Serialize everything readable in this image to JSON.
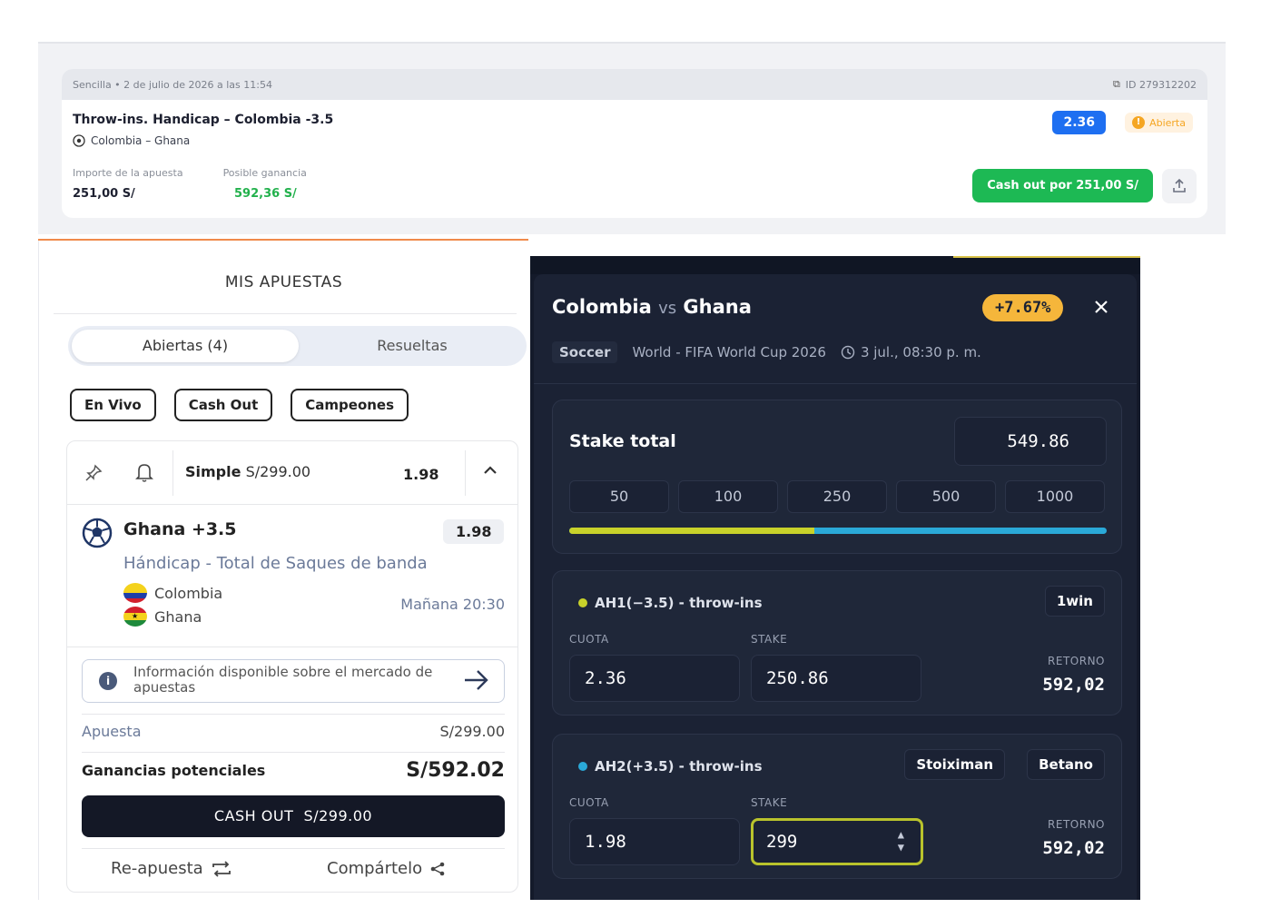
{
  "top_bet": {
    "header_left": "Sencilla • 2 de julio de 2026 a las 11:54",
    "header_id": "ID 279312202",
    "title": "Throw-ins. Handicap – Colombia -3.5",
    "match": "Colombia – Ghana",
    "stake_label": "Importe de la apuesta",
    "stake_value": "251,00 S/",
    "win_label": "Posible ganancia",
    "win_value": "592,36 S/",
    "odds": "2.36",
    "status": "Abierta",
    "cashout_label": "Cash out por 251,00 S/"
  },
  "my_bets": {
    "title": "MIS APUESTAS",
    "tabs": {
      "open": "Abiertas (4)",
      "settled": "Resueltas"
    },
    "chips": [
      "En Vivo",
      "Cash Out",
      "Campeones"
    ],
    "bet": {
      "type_label": "Simple",
      "type_amount": "S/299.00",
      "odds": "1.98",
      "selection": "Ghana +3.5",
      "selection_odds": "1.98",
      "market": "Hándicap - Total de Saques de banda",
      "team1": "Colombia",
      "team2": "Ghana",
      "date": "Mañana 20:30",
      "info": "Información disponible sobre el mercado de apuestas",
      "stake_label": "Apuesta",
      "stake_value": "S/299.00",
      "potential_label": "Ganancias potenciales",
      "potential_value": "S/592.02",
      "cashout_text": "CASH OUT  S/299.00",
      "rebet": "Re-apuesta",
      "share": "Compártelo"
    }
  },
  "arb": {
    "team1": "Colombia",
    "vs": "vs",
    "team2": "Ghana",
    "percent": "+7.67%",
    "sport": "Soccer",
    "competition": "World - FIFA World Cup 2026",
    "datetime": "3 jul., 08:30 p. m.",
    "stake_total_label": "Stake total",
    "stake_total": "549.86",
    "quick_amounts": [
      "50",
      "100",
      "250",
      "500",
      "1000"
    ],
    "split_fraction": 0.456,
    "odds_label": "CUOTA",
    "stake_label": "STAKE",
    "return_label": "RETORNO",
    "bets": [
      {
        "name": "AH1(−3.5) - throw-ins",
        "books": [
          "1win"
        ],
        "odds": "2.36",
        "stake": "250.86",
        "return": "592,02",
        "color": "#c8d22a"
      },
      {
        "name": "AH2(+3.5) - throw-ins",
        "books": [
          "Stoiximan",
          "Betano"
        ],
        "odds": "1.98",
        "stake": "299",
        "return": "592,02",
        "color": "#2aa9d8"
      }
    ]
  }
}
